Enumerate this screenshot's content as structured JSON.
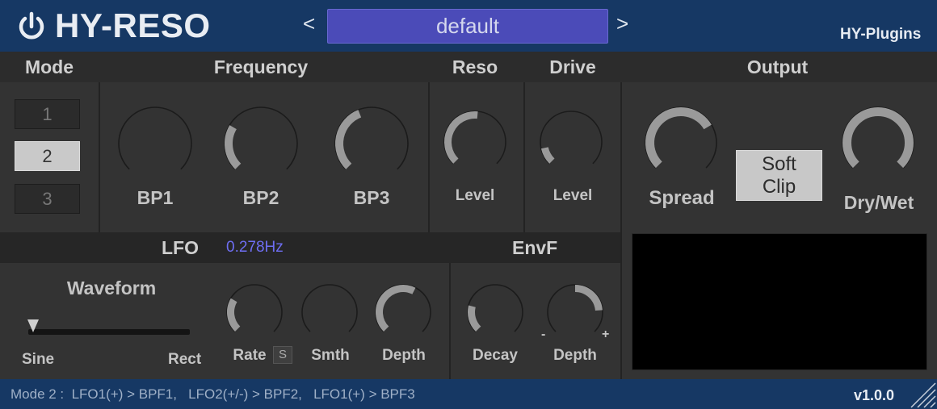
{
  "header": {
    "title": "HY-RESO",
    "prev": "<",
    "next": ">",
    "preset": "default",
    "brand": "HY-Plugins"
  },
  "sections": {
    "mode": "Mode",
    "frequency": "Frequency",
    "reso": "Reso",
    "drive": "Drive",
    "output": "Output"
  },
  "mode_buttons": [
    {
      "label": "1",
      "selected": false
    },
    {
      "label": "2",
      "selected": true
    },
    {
      "label": "3",
      "selected": false
    }
  ],
  "frequency": {
    "bp1": {
      "label": "BP1",
      "value": 0.0
    },
    "bp2": {
      "label": "BP2",
      "value": 0.28
    },
    "bp3": {
      "label": "BP3",
      "value": 0.42
    }
  },
  "reso": {
    "label": "Level",
    "value": 0.52
  },
  "drive": {
    "label": "Level",
    "value": 0.12
  },
  "output": {
    "spread": {
      "label": "Spread",
      "value": 0.72
    },
    "softclip_line1": "Soft",
    "softclip_line2": "Clip",
    "drywet": {
      "label": "Dry/Wet",
      "value": 1.0
    }
  },
  "lfo": {
    "title": "LFO",
    "freq_readout": "0.278Hz",
    "waveform_label": "Waveform",
    "sine": "Sine",
    "rect": "Rect",
    "waveform_value": 0.0,
    "rate": {
      "label": "Rate",
      "value": 0.28
    },
    "sync": "S",
    "smth": {
      "label": "Smth",
      "value": 0.0
    },
    "depth": {
      "label": "Depth",
      "value": 0.6
    }
  },
  "envf": {
    "title": "EnvF",
    "decay": {
      "label": "Decay",
      "value": 0.22
    },
    "depth": {
      "label": "Depth",
      "value": 0.5,
      "minus": "-",
      "plus": "+"
    }
  },
  "footer": {
    "status": "Mode 2 :  LFO1(+) > BPF1,   LFO2(+/-) > BPF2,   LFO1(+) > BPF3",
    "version": "v1.0.0"
  },
  "colors": {
    "header_bg": "#163864",
    "preset_bg": "#4b4bb8",
    "knob_track": "#1b1b1b",
    "knob_value": "#9a9a9a",
    "accent_readout": "#6e6ef2"
  }
}
